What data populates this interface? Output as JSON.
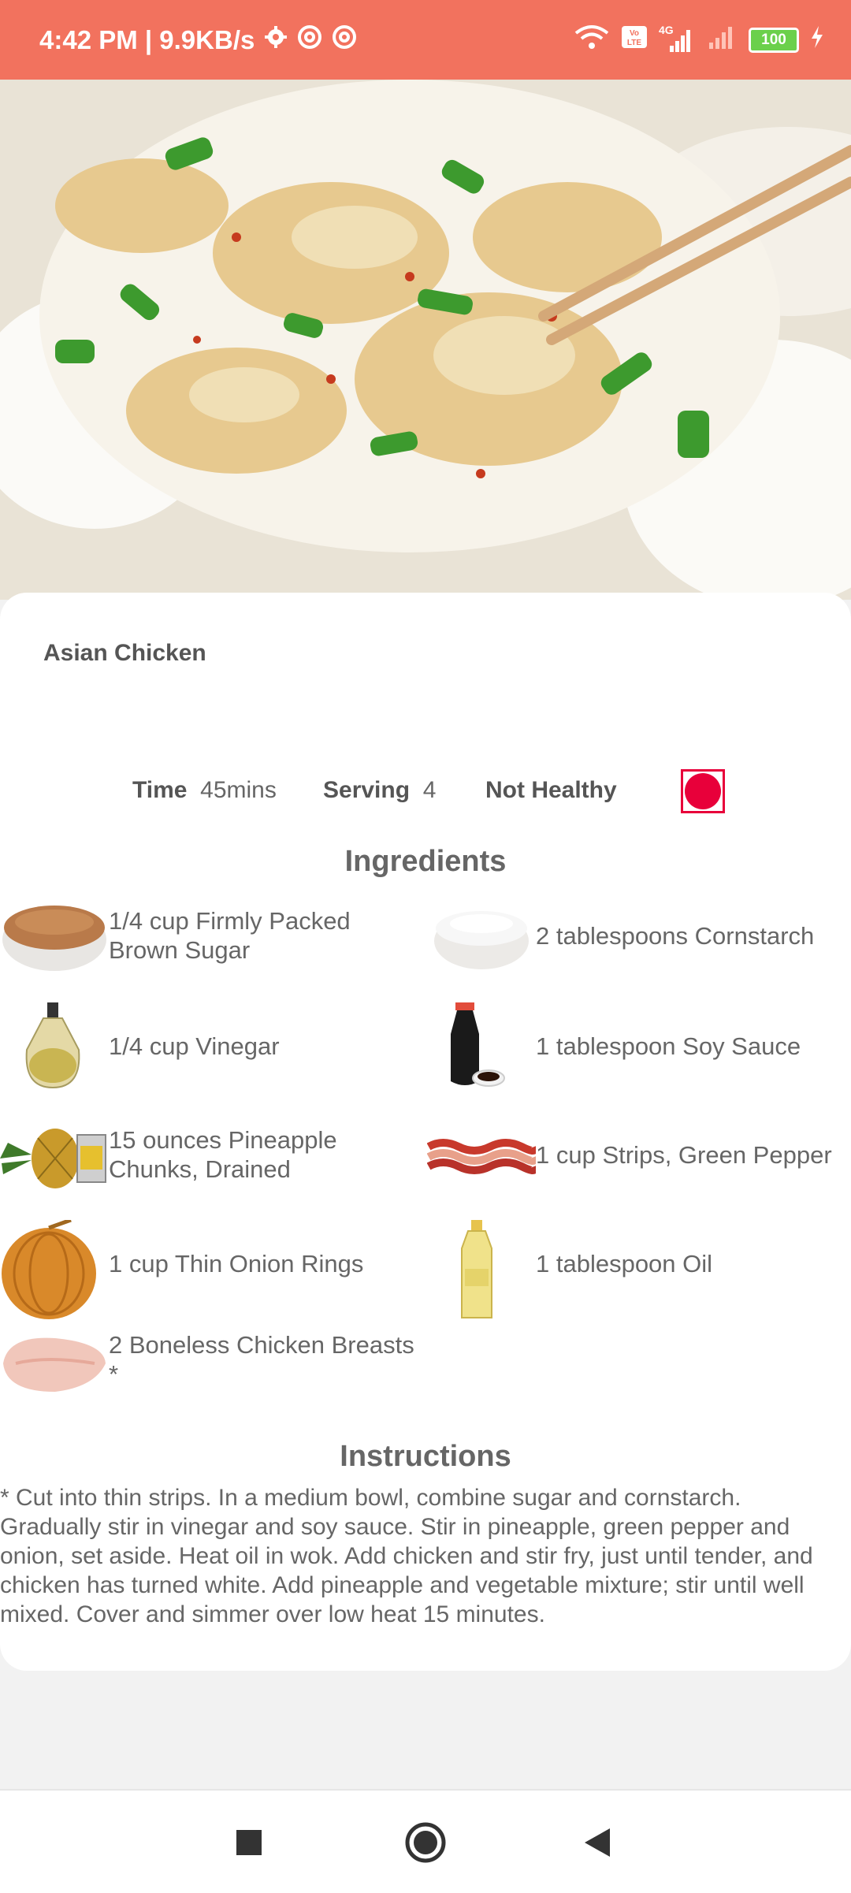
{
  "status_bar": {
    "time_speed": "4:42 PM | 9.9KB/s",
    "network": "4G",
    "battery": "100"
  },
  "recipe": {
    "title": "Asian Chicken",
    "time_label": "Time",
    "time_value": "45mins",
    "serving_label": "Serving",
    "serving_value": "4",
    "health": "Not Healthy",
    "indicator_color": "#e8003a"
  },
  "ingredients_heading": "Ingredients",
  "ingredients": [
    {
      "text": "1/4 cup Firmly Packed Brown Sugar",
      "icon": "brown-sugar-bowl-icon"
    },
    {
      "text": "2 tablespoons Cornstarch",
      "icon": "cornstarch-bowl-icon"
    },
    {
      "text": "1/4 cup Vinegar",
      "icon": "vinegar-bottle-icon"
    },
    {
      "text": "1 tablespoon Soy Sauce",
      "icon": "soy-sauce-bottle-icon"
    },
    {
      "text": "15 ounces Pineapple Chunks, Drained",
      "icon": "pineapple-can-icon"
    },
    {
      "text": "1 cup Strips, Green Pepper",
      "icon": "bacon-strips-icon"
    },
    {
      "text": "1 cup Thin Onion Rings",
      "icon": "onion-icon"
    },
    {
      "text": "1 tablespoon Oil",
      "icon": "oil-bottle-icon"
    },
    {
      "text": "2 Boneless Chicken Breasts\n*",
      "icon": "chicken-breast-icon"
    }
  ],
  "instructions_heading": "Instructions",
  "instructions": "* Cut into thin strips. In a medium bowl, combine sugar and cornstarch. Gradually stir in vinegar and soy sauce. Stir in pineapple, green pepper and onion, set aside. Heat oil in wok. Add chicken and stir fry, just until tender, and chicken has turned white. Add pineapple and vegetable mixture; stir until well mixed. Cover and simmer over low heat 15 minutes.",
  "colors": {
    "status_bar": "#f2725e",
    "accent": "#e8003a"
  }
}
